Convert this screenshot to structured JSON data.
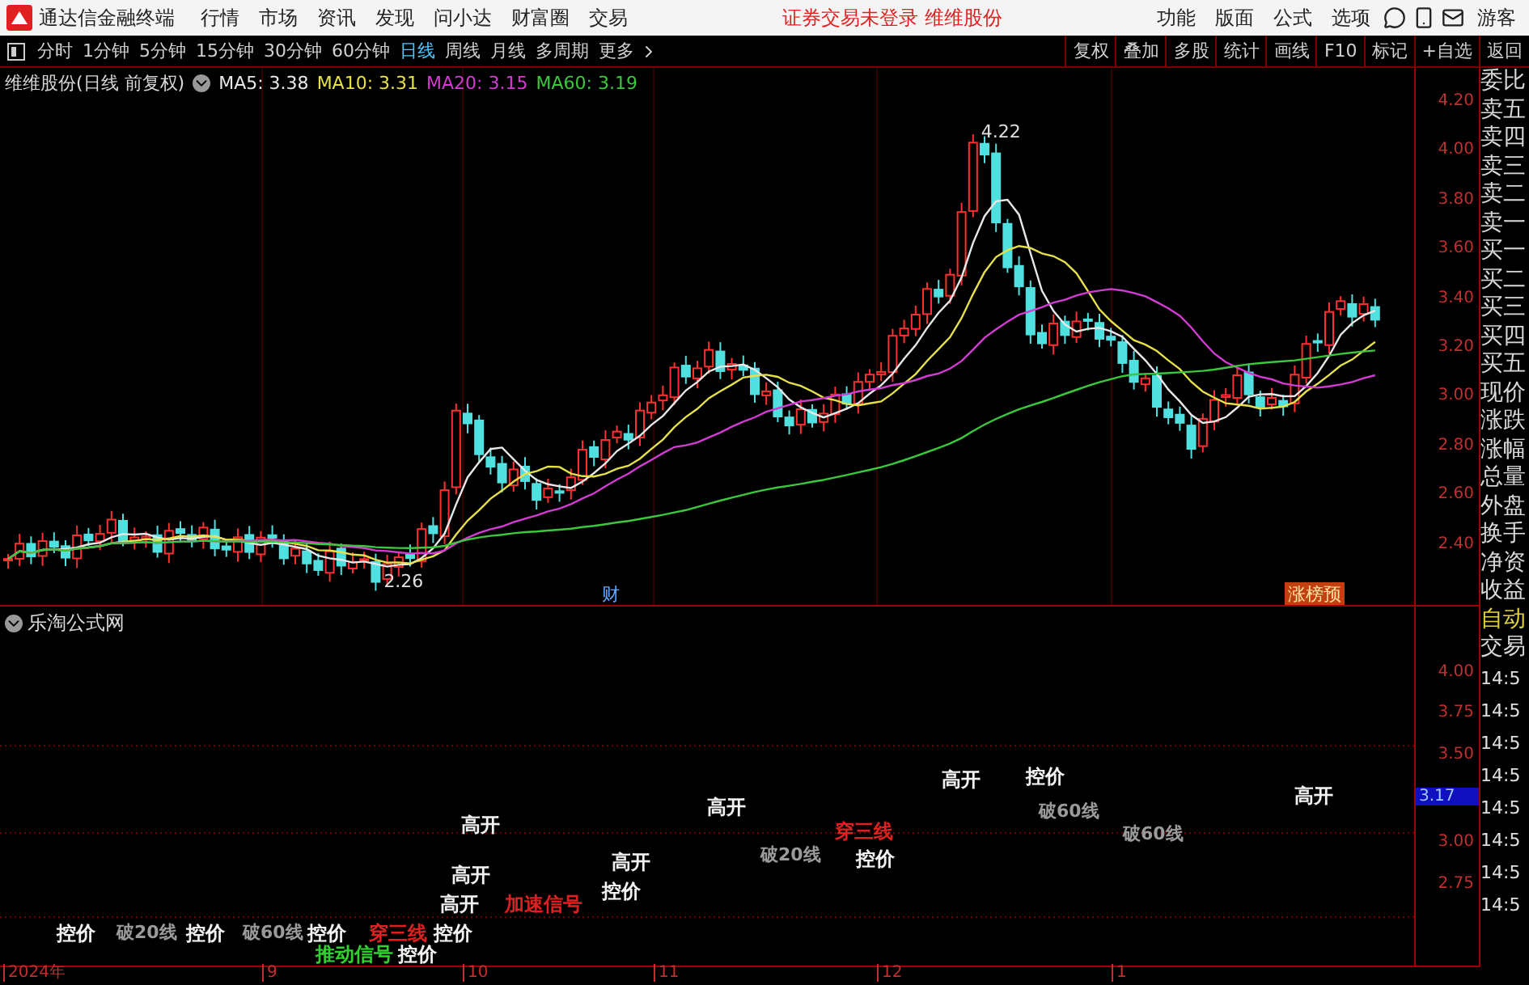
{
  "app": {
    "title": "通达信金融终端"
  },
  "menu": [
    {
      "label": "行情"
    },
    {
      "label": "市场"
    },
    {
      "label": "资讯"
    },
    {
      "label": "发现"
    },
    {
      "label": "问小达"
    },
    {
      "label": "财富圈"
    },
    {
      "label": "交易"
    }
  ],
  "login_status": "证券交易未登录",
  "stock_name": "维维股份",
  "menu_right": [
    {
      "label": "功能"
    },
    {
      "label": "版面"
    },
    {
      "label": "公式"
    },
    {
      "label": "选项"
    }
  ],
  "user": "游客",
  "periods": [
    {
      "label": "分时",
      "selected": false
    },
    {
      "label": "1分钟",
      "selected": false
    },
    {
      "label": "5分钟",
      "selected": false
    },
    {
      "label": "15分钟",
      "selected": false
    },
    {
      "label": "30分钟",
      "selected": false
    },
    {
      "label": "60分钟",
      "selected": false
    },
    {
      "label": "日线",
      "selected": true
    },
    {
      "label": "周线",
      "selected": false
    },
    {
      "label": "月线",
      "selected": false
    },
    {
      "label": "多周期",
      "selected": false
    },
    {
      "label": "更多",
      "selected": false
    }
  ],
  "tools": [
    {
      "label": "复权"
    },
    {
      "label": "叠加"
    },
    {
      "label": "多股"
    },
    {
      "label": "统计"
    },
    {
      "label": "画线"
    },
    {
      "label": "F10"
    },
    {
      "label": "标记"
    },
    {
      "label": "+自选"
    },
    {
      "label": "返回"
    }
  ],
  "chart": {
    "title": "维维股份(日线 前复权)",
    "indicators": [
      {
        "label": "MA5: 3.38",
        "color": "#e8e8e8"
      },
      {
        "label": "MA10: 3.31",
        "color": "#e6e04a"
      },
      {
        "label": "MA20: 3.15",
        "color": "#d23cd2"
      },
      {
        "label": "MA60: 3.19",
        "color": "#3cc83c"
      }
    ],
    "price_ticks": [
      "4.20",
      "4.00",
      "3.80",
      "3.60",
      "3.40",
      "3.20",
      "3.00",
      "2.80",
      "2.60",
      "2.40"
    ],
    "high_label": "4.22",
    "low_label": "2.26",
    "markers": [
      {
        "text": "财",
        "kind": "finance"
      },
      {
        "text": "涨榜预",
        "kind": "rank"
      }
    ]
  },
  "lower_panel": {
    "title": "乐淘公式网",
    "signals": [
      {
        "text": "控价",
        "kind": "plain"
      },
      {
        "text": "破20线",
        "kind": "break"
      },
      {
        "text": "控价",
        "kind": "plain"
      },
      {
        "text": "破60线",
        "kind": "break"
      },
      {
        "text": "控价",
        "kind": "plain"
      },
      {
        "text": "推动信号",
        "kind": "push"
      },
      {
        "text": "穿三线",
        "kind": "cross"
      },
      {
        "text": "控价",
        "kind": "plain"
      },
      {
        "text": "控价",
        "kind": "plain"
      },
      {
        "text": "高开",
        "kind": "plain"
      },
      {
        "text": "高开",
        "kind": "plain"
      },
      {
        "text": "高开",
        "kind": "plain"
      },
      {
        "text": "加速信号",
        "kind": "cross"
      },
      {
        "text": "控价",
        "kind": "plain"
      },
      {
        "text": "高开",
        "kind": "plain"
      },
      {
        "text": "高开",
        "kind": "plain"
      },
      {
        "text": "破20线",
        "kind": "break"
      },
      {
        "text": "穿三线",
        "kind": "cross"
      },
      {
        "text": "控价",
        "kind": "plain"
      },
      {
        "text": "高开",
        "kind": "plain"
      },
      {
        "text": "控价",
        "kind": "plain"
      },
      {
        "text": "破60线",
        "kind": "break"
      },
      {
        "text": "破60线",
        "kind": "break"
      },
      {
        "text": "高开",
        "kind": "plain"
      }
    ],
    "ticks": [
      "4.00",
      "3.75",
      "3.50",
      "3.00",
      "2.75"
    ],
    "current_value": "3.17"
  },
  "side_panel": {
    "quote_labels": [
      "委比",
      "卖五",
      "卖四",
      "卖三",
      "卖二",
      "卖一",
      "买一",
      "买二",
      "买三",
      "买四",
      "买五",
      "现价",
      "涨跌",
      "涨幅",
      "总量",
      "外盘",
      "换手",
      "净资",
      "收益"
    ],
    "mode": "自动",
    "trade_label": "交易",
    "times": [
      "14:5",
      "14:5",
      "14:5",
      "14:5",
      "14:5",
      "14:5",
      "14:5",
      "14:5"
    ]
  },
  "date_axis": [
    "2024年",
    "9",
    "10",
    "11",
    "12",
    "1"
  ]
}
